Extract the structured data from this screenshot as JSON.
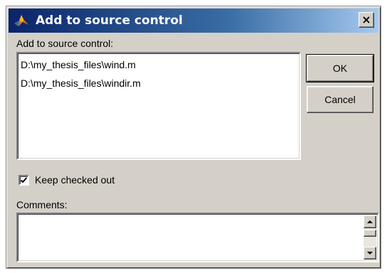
{
  "window": {
    "title": "Add to source control",
    "close_label": "×"
  },
  "files_label": "Add to source control:",
  "files": [
    "D:\\my_thesis_files\\wind.m",
    "D:\\my_thesis_files\\windir.m"
  ],
  "buttons": {
    "ok": "OK",
    "cancel": "Cancel"
  },
  "keep_checked_out": {
    "label": "Keep checked out",
    "checked": true
  },
  "comments": {
    "label": "Comments:",
    "value": ""
  },
  "icons": {
    "title": "matlab-logo-icon",
    "check": "checkmark-icon",
    "scroll_up": "arrow-up-icon",
    "scroll_down": "arrow-down-icon"
  }
}
